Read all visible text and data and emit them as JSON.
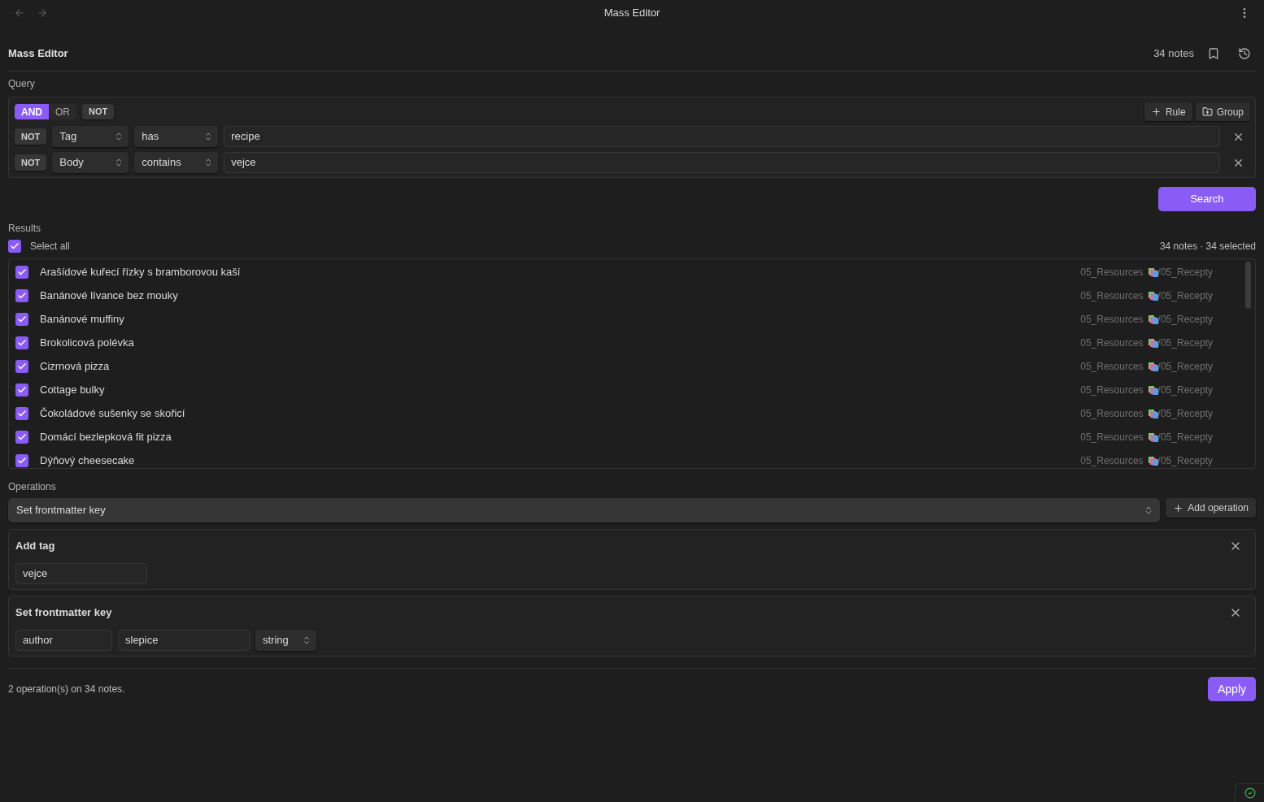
{
  "titlebar": {
    "title": "Mass Editor"
  },
  "header": {
    "title": "Mass Editor",
    "note_count": "34 notes"
  },
  "query": {
    "label": "Query",
    "operators": [
      {
        "label": "AND",
        "selected": true
      },
      {
        "label": "OR",
        "selected": false
      }
    ],
    "group_not": {
      "label": "NOT",
      "on": false
    },
    "actions": [
      {
        "kind": "rule",
        "label": "Rule"
      },
      {
        "kind": "group",
        "label": "Group"
      }
    ],
    "rules": [
      {
        "not": {
          "label": "NOT",
          "on": false
        },
        "field": "Tag",
        "operator": "has",
        "value": "recipe"
      },
      {
        "not": {
          "label": "NOT",
          "on": false
        },
        "field": "Body",
        "operator": "contains",
        "value": "vejce"
      }
    ],
    "search_button": "Search"
  },
  "results": {
    "label": "Results",
    "select_all": {
      "label": "Select all",
      "checked": true
    },
    "summary": "34 notes · 34 selected",
    "notes": [
      {
        "title": "Arašídové kuřecí řízky s bramborovou kaší",
        "checked": true,
        "folder": "05_Resources",
        "subfolder": "/05_Recepty"
      },
      {
        "title": "Banánové lívance bez mouky",
        "checked": true,
        "folder": "05_Resources",
        "subfolder": "/05_Recepty"
      },
      {
        "title": "Banánové muffiny",
        "checked": true,
        "folder": "05_Resources",
        "subfolder": "/05_Recepty"
      },
      {
        "title": "Brokolicová polévka",
        "checked": true,
        "folder": "05_Resources",
        "subfolder": "/05_Recepty"
      },
      {
        "title": "Cizrnová pizza",
        "checked": true,
        "folder": "05_Resources",
        "subfolder": "/05_Recepty"
      },
      {
        "title": "Cottage bulky",
        "checked": true,
        "folder": "05_Resources",
        "subfolder": "/05_Recepty"
      },
      {
        "title": "Čokoládové sušenky se skořicí",
        "checked": true,
        "folder": "05_Resources",
        "subfolder": "/05_Recepty"
      },
      {
        "title": "Domácí bezlepková fit pizza",
        "checked": true,
        "folder": "05_Resources",
        "subfolder": "/05_Recepty"
      },
      {
        "title": "Dýňový cheesecake",
        "checked": true,
        "folder": "05_Resources",
        "subfolder": "/05_Recepty"
      }
    ]
  },
  "operations": {
    "label": "Operations",
    "picker": "Set frontmatter key",
    "add_button": "Add operation",
    "cards": [
      {
        "kind": "add_tag",
        "title": "Add tag",
        "value": "vejce"
      },
      {
        "kind": "set_frontmatter",
        "title": "Set frontmatter key",
        "key": "author",
        "value": "slepice",
        "type": "string"
      }
    ]
  },
  "footer": {
    "summary": "2 operation(s) on 34 notes.",
    "apply_button": "Apply"
  }
}
